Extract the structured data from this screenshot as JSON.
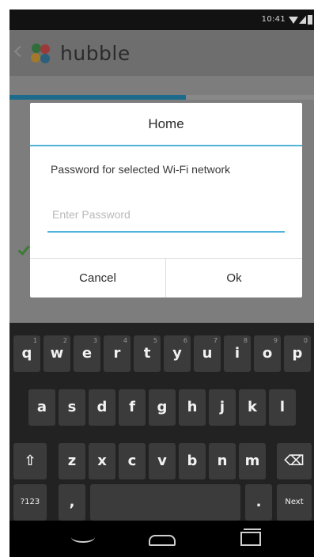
{
  "status_bar": {
    "time": "10:41"
  },
  "app": {
    "title": "hubble",
    "progress": 0.58
  },
  "dialog": {
    "title": "Home",
    "message": "Password for selected Wi-Fi network",
    "password_placeholder": "Enter Password",
    "password_value": "",
    "cancel_label": "Cancel",
    "ok_label": "Ok"
  },
  "keyboard": {
    "row1": [
      {
        "label": "q",
        "hint": "1"
      },
      {
        "label": "w",
        "hint": "2"
      },
      {
        "label": "e",
        "hint": "3"
      },
      {
        "label": "r",
        "hint": "4"
      },
      {
        "label": "t",
        "hint": "5"
      },
      {
        "label": "y",
        "hint": "6"
      },
      {
        "label": "u",
        "hint": "7"
      },
      {
        "label": "i",
        "hint": "8"
      },
      {
        "label": "o",
        "hint": "9"
      },
      {
        "label": "p",
        "hint": "0"
      }
    ],
    "row2": [
      "a",
      "s",
      "d",
      "f",
      "g",
      "h",
      "j",
      "k",
      "l"
    ],
    "row3": [
      "z",
      "x",
      "c",
      "v",
      "b",
      "n",
      "m"
    ],
    "shift_label": "⇧",
    "backspace_label": "⌫",
    "symbols_label": "?123",
    "comma_label": ",",
    "period_label": ".",
    "next_label": "Next"
  },
  "colors": {
    "accent": "#4fb2d8",
    "progress": "#1d6b8c"
  }
}
